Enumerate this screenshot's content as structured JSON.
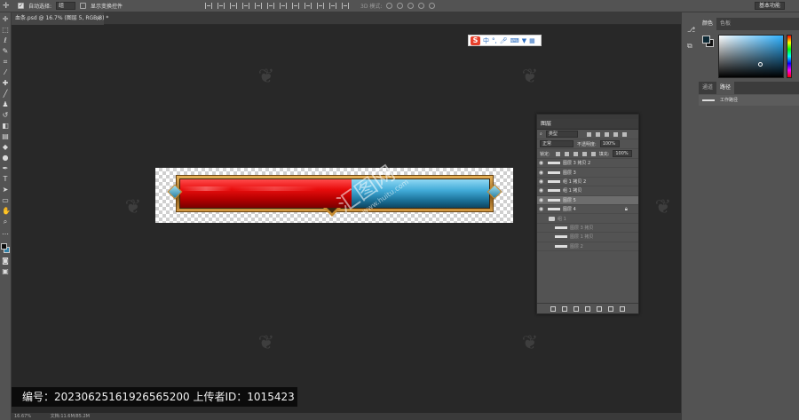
{
  "options_bar": {
    "auto_select_label": "自动选择:",
    "auto_select_value": "组",
    "show_transform_label": "显示变换控件",
    "mode_3d_label": "3D 模式:",
    "workspace": "基本功能"
  },
  "document": {
    "tab_title": "血条.psd @ 16.7% (图层 5, RGB/8) *",
    "tab_close": "×",
    "zoom_status": "16.67%",
    "doc_status": "文档:11.6M/85.2M"
  },
  "ime": {
    "logo": "S",
    "lang": "中"
  },
  "canvas_watermark": {
    "main": "汇图网",
    "sub": "www.huitu.com"
  },
  "caption": "编号：20230625161926565200  上传者ID：1015423",
  "color_panel": {
    "tabs": [
      "颜色",
      "色板"
    ],
    "fg_color": "#0e2a36",
    "bg_color": "#111111",
    "hue_color": "#2fb1ff"
  },
  "paths_panel": {
    "tabs": [
      "通道",
      "路径"
    ],
    "work_path": "工作路径"
  },
  "layers_panel": {
    "title": "图层",
    "filter_label": "类型",
    "blend_mode": "正常",
    "opacity_label": "不透明度:",
    "opacity_value": "100%",
    "lock_label": "锁定:",
    "fill_label": "填充:",
    "fill_value": "100%",
    "layers": [
      {
        "name": "图层 3 拷贝 2",
        "visible": true,
        "kind": "layer"
      },
      {
        "name": "图层 3",
        "visible": true,
        "kind": "layer"
      },
      {
        "name": "组 1 拷贝 2",
        "visible": true,
        "kind": "layer"
      },
      {
        "name": "组 1 拷贝",
        "visible": true,
        "kind": "layer"
      },
      {
        "name": "图层 5",
        "visible": true,
        "kind": "layer",
        "selected": true
      },
      {
        "name": "图层 4",
        "visible": true,
        "kind": "layer",
        "locked": true
      },
      {
        "name": "组 1",
        "visible": false,
        "kind": "group"
      },
      {
        "name": "图层 3 拷贝",
        "visible": false,
        "kind": "layer",
        "indent": true
      },
      {
        "name": "图层 1 拷贝",
        "visible": false,
        "kind": "layer",
        "indent": true
      },
      {
        "name": "图层 2",
        "visible": false,
        "kind": "layer",
        "indent": true
      }
    ]
  },
  "healthbar": {
    "fill_fraction": 0.55,
    "red": "#e90d0d",
    "blue": "#3fa9d6",
    "frame": "#c48a30"
  }
}
